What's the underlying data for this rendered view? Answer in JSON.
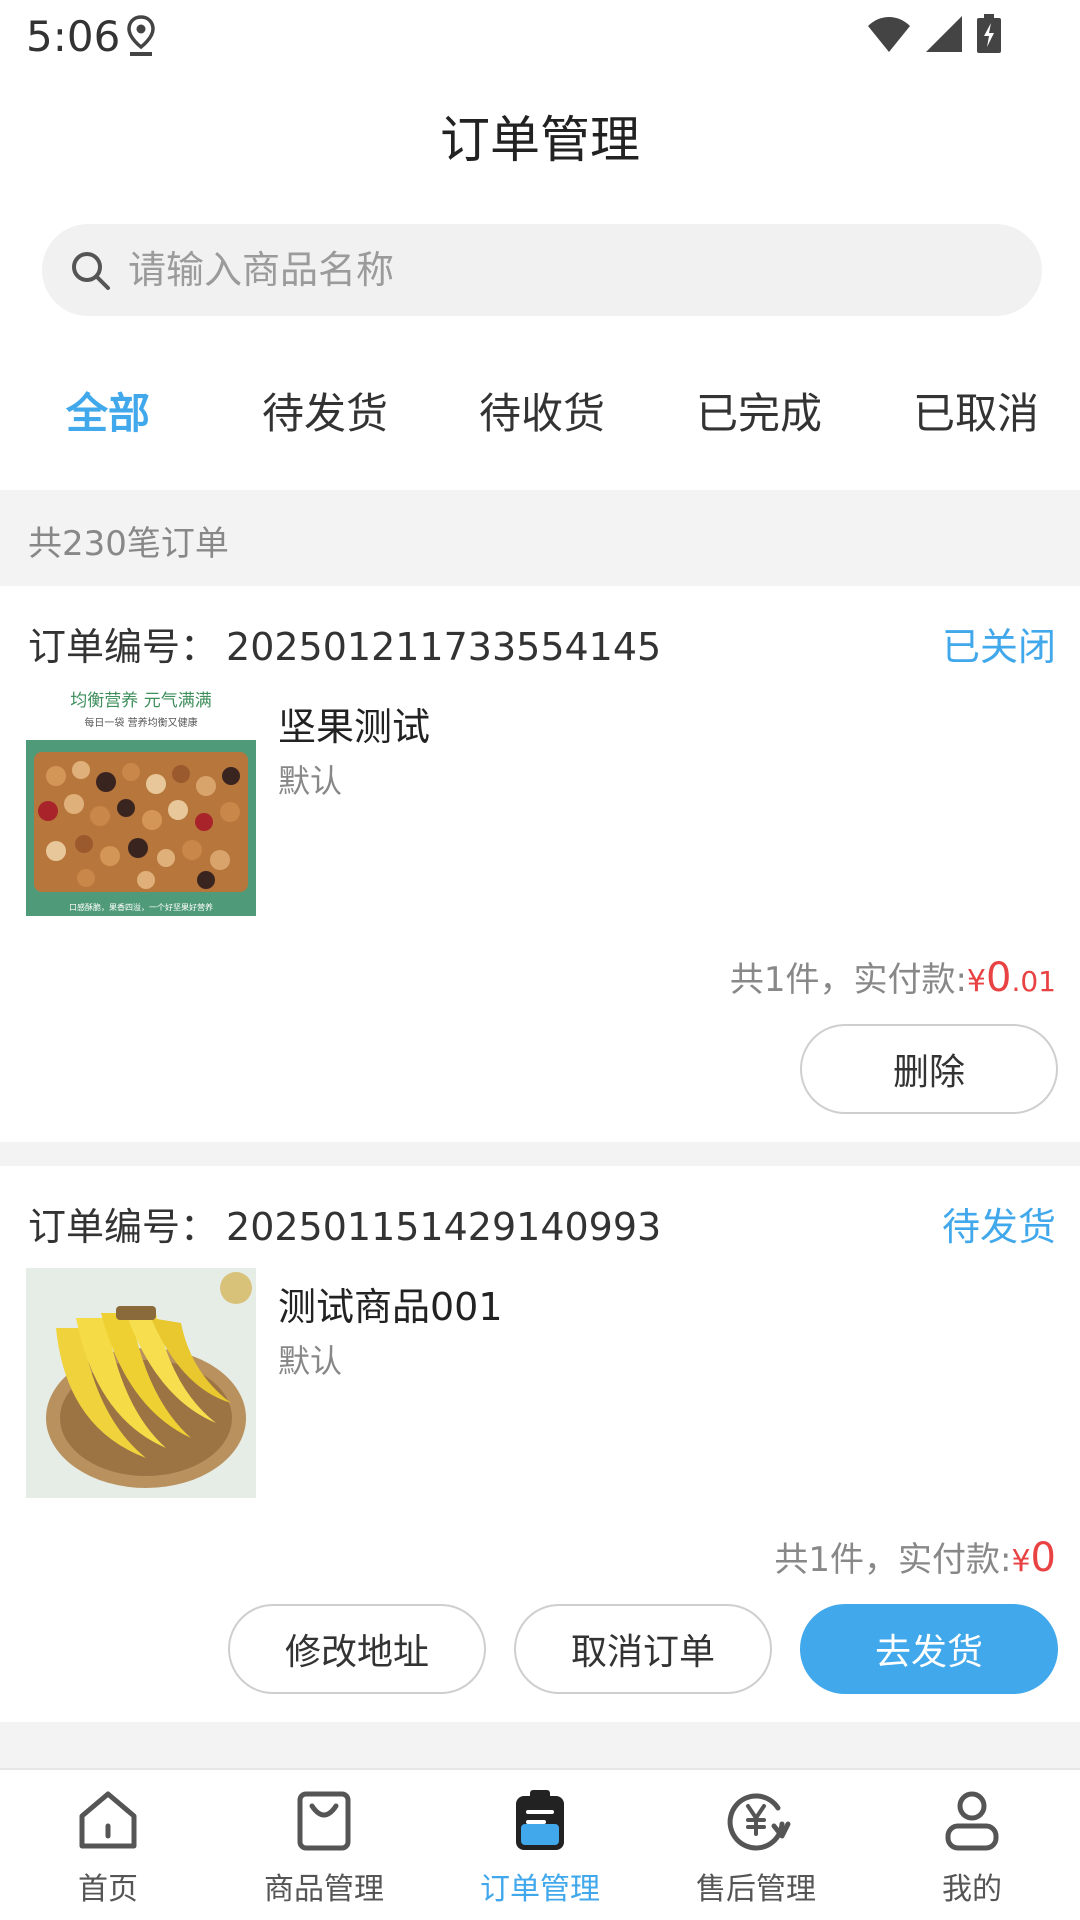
{
  "status_bar": {
    "time": "5:06",
    "icons": [
      "location-icon",
      "wifi-icon",
      "signal-icon",
      "battery-charging-icon"
    ]
  },
  "header": {
    "title": "订单管理"
  },
  "search": {
    "placeholder": "请输入商品名称",
    "value": ""
  },
  "tabs": [
    {
      "label": "全部",
      "active": true
    },
    {
      "label": "待发货",
      "active": false
    },
    {
      "label": "待收货",
      "active": false
    },
    {
      "label": "已完成",
      "active": false
    },
    {
      "label": "已取消",
      "active": false
    }
  ],
  "summary": {
    "count_text": "共230笔订单"
  },
  "orders": [
    {
      "order_label": "订单编号：",
      "order_no": "202501211733554145",
      "status": "已关闭",
      "product_name": "坚果测试",
      "spec": "默认",
      "image_banner_title": "均衡营养 元气满满",
      "image_banner_sub": "每日一袋 营养均衡又健康",
      "image_footer_text": "口感酥脆，果香四溢，一个好坚果好营养",
      "price_prefix": "共1件，实付款:",
      "currency": "¥",
      "price_int": "0",
      "price_dec": ".01",
      "actions": [
        "删除"
      ]
    },
    {
      "order_label": "订单编号：",
      "order_no": "202501151429140993",
      "status": "待发货",
      "product_name": "测试商品001",
      "spec": "默认",
      "price_prefix": "共1件，实付款:",
      "currency": "¥",
      "price_int": "0",
      "price_dec": "",
      "actions": [
        "修改地址",
        "取消订单",
        "去发货"
      ]
    }
  ],
  "bottom_nav": [
    {
      "label": "首页",
      "icon": "home-icon",
      "active": false
    },
    {
      "label": "商品管理",
      "icon": "shopping-bag-icon",
      "active": false
    },
    {
      "label": "订单管理",
      "icon": "clipboard-icon",
      "active": true
    },
    {
      "label": "售后管理",
      "icon": "yuan-refund-icon",
      "active": false
    },
    {
      "label": "我的",
      "icon": "user-icon",
      "active": false
    }
  ],
  "colors": {
    "accent": "#41a8ec",
    "price": "#e94242",
    "background_gray": "#f3f3f3"
  }
}
